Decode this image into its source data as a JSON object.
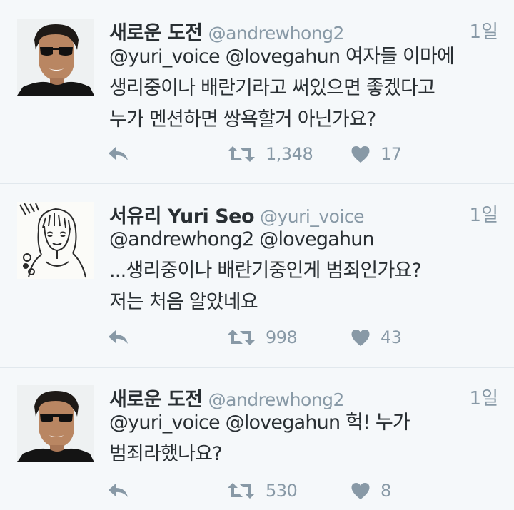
{
  "tweets": [
    {
      "name": "새로운 도전",
      "handle": "@andrewhong2",
      "time": "1일",
      "lines": [
        "@yuri_voice @lovegahun 여자들 이마에",
        "생리중이나 배란기라고 써있으면 좋겠다고",
        "누가 멘션하면 쌍욕할거 아닌가요?"
      ],
      "retweets": "1,348",
      "likes": "17",
      "avatar": "man-sunglasses-avatar"
    },
    {
      "name": "서유리 Yuri Seo",
      "handle": "@yuri_voice",
      "time": "1일",
      "lines": [
        "@andrewhong2 @lovegahun",
        "...생리중이나 배란기중인게 범죄인가요?",
        "저는 처음 알았네요"
      ],
      "retweets": "998",
      "likes": "43",
      "avatar": "sketch-girl-avatar"
    },
    {
      "name": "새로운 도전",
      "handle": "@andrewhong2",
      "time": "1일",
      "lines": [
        "@yuri_voice @lovegahun 헉! 누가",
        "범죄라했나요?"
      ],
      "retweets": "530",
      "likes": "8",
      "avatar": "man-sunglasses-avatar"
    }
  ],
  "colors": {
    "background": "#f5f8fa",
    "text": "#292f33",
    "muted": "#8899a6",
    "divider": "#e1e8ed"
  },
  "icons": [
    "reply-icon",
    "retweet-icon",
    "like-icon"
  ]
}
